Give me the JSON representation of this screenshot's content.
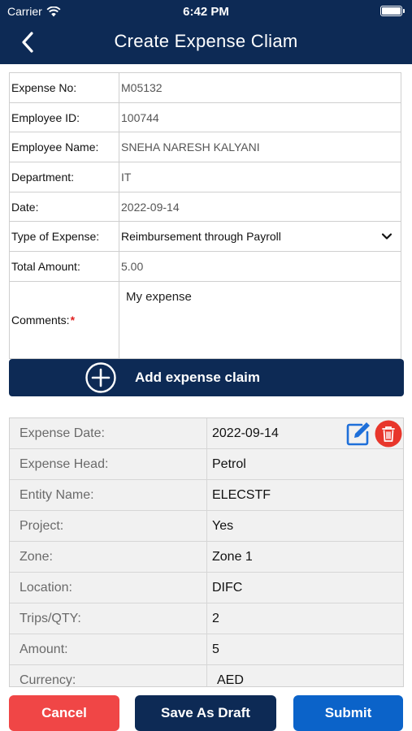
{
  "status_bar": {
    "carrier": "Carrier",
    "time": "6:42 PM"
  },
  "nav": {
    "title": "Create Expense Cliam",
    "back_icon": "chevron-left-icon"
  },
  "form": {
    "expense_no": {
      "label": "Expense No:",
      "value": "M05132"
    },
    "employee_id": {
      "label": "Employee ID:",
      "value": "100744"
    },
    "employee_name": {
      "label": "Employee Name:",
      "value": "SNEHA NARESH KALYANI"
    },
    "department": {
      "label": "Department:",
      "value": "IT"
    },
    "date": {
      "label": "Date:",
      "value": "2022-09-14"
    },
    "type_of_expense": {
      "label": "Type of Expense:",
      "value": "Reimbursement through Payroll"
    },
    "total_amount": {
      "label": "Total Amount:",
      "value": "5.00"
    },
    "comments": {
      "label": "Comments:",
      "required_mark": "*",
      "value": "My expense"
    }
  },
  "add_button": {
    "label": "Add expense claim",
    "icon": "plus-circle-icon"
  },
  "claim": {
    "expense_date": {
      "label": "Expense Date:",
      "value": "2022-09-14"
    },
    "expense_head": {
      "label": "Expense Head:",
      "value": "Petrol"
    },
    "entity_name": {
      "label": "Entity Name:",
      "value": "ELECSTF"
    },
    "project": {
      "label": "Project:",
      "value": "Yes"
    },
    "zone": {
      "label": "Zone:",
      "value": "Zone 1"
    },
    "location": {
      "label": "Location:",
      "value": "DIFC"
    },
    "trips_qty": {
      "label": "Trips/QTY:",
      "value": "2"
    },
    "amount": {
      "label": "Amount:",
      "value": "5"
    },
    "currency": {
      "label": "Currency:",
      "value": "AED"
    }
  },
  "actions": {
    "cancel": "Cancel",
    "save_draft": "Save As Draft",
    "submit": "Submit"
  },
  "colors": {
    "navy": "#0d2a55",
    "cancel": "#f04646",
    "submit": "#0b63c9",
    "edit": "#1e6fd9",
    "delete": "#e8362b"
  }
}
